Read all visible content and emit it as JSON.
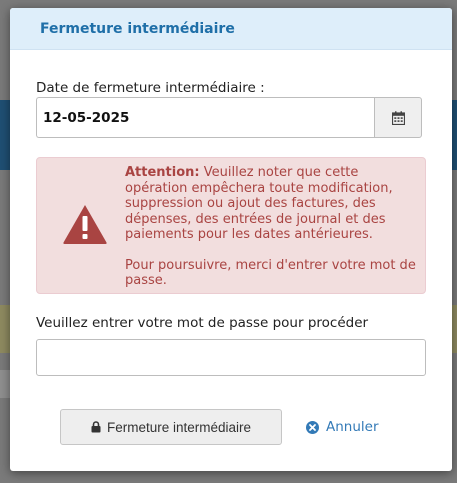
{
  "modal": {
    "title": "Fermeture intermédiaire",
    "date_label": "Date de fermeture intermédiaire :",
    "date_value": "12-05-2025",
    "alert": {
      "heading": "Attention:",
      "body": " Veuillez noter que cette opération empêchera toute modification, suppression ou ajout des factures, des dépenses, des entrées de journal et des paiements pour les dates antérieures.",
      "footer": "Pour poursuivre, merci d'entrer votre mot de passe."
    },
    "password_label": "Veuillez entrer votre mot de passe pour procéder",
    "password_value": "",
    "submit_label": "Fermeture intermédiaire",
    "cancel_label": "Annuler"
  },
  "icons": {
    "calendar": "calendar-icon",
    "warning": "warning-triangle-icon",
    "lock": "lock-icon",
    "cancel": "times-circle-icon"
  },
  "colors": {
    "header_bg": "#deeefa",
    "title": "#1f6fa8",
    "alert_bg": "#f2dede",
    "alert_text": "#a94442",
    "link": "#337ab7"
  }
}
